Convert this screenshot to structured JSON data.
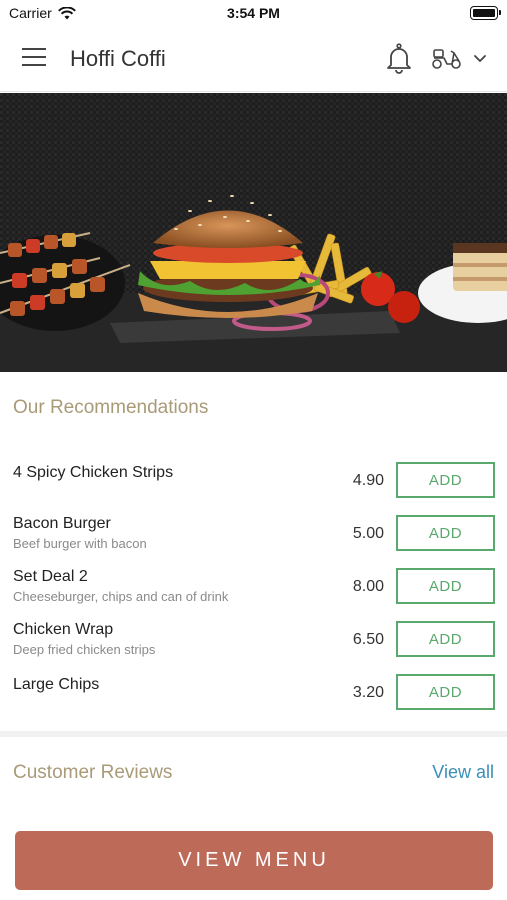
{
  "status_bar": {
    "carrier": "Carrier",
    "time": "3:54 PM"
  },
  "header": {
    "title": "Hoffi Coffi",
    "icons": [
      "menu-icon",
      "bell-icon",
      "scooter-icon",
      "chevron-down-icon"
    ]
  },
  "hero": {
    "image": "burger-fries-kebab-photo"
  },
  "recommendations": {
    "title": "Our Recommendations",
    "add_label": "ADD",
    "items": [
      {
        "name": "4 Spicy Chicken Strips",
        "description": "",
        "price": "4.90"
      },
      {
        "name": "Bacon Burger",
        "description": "Beef burger with bacon",
        "price": "5.00"
      },
      {
        "name": "Set Deal 2",
        "description": "Cheeseburger, chips and can of drink",
        "price": "8.00"
      },
      {
        "name": "Chicken Wrap",
        "description": "Deep fried chicken strips",
        "price": "6.50"
      },
      {
        "name": "Large Chips",
        "description": "",
        "price": "3.20"
      }
    ]
  },
  "reviews": {
    "title": "Customer Reviews",
    "view_all_label": "View all"
  },
  "footer": {
    "view_menu_label": "VIEW MENU"
  },
  "colors": {
    "accent_gold": "#a99a78",
    "add_green": "#5aa86e",
    "link_blue": "#3b8fb8",
    "cta_terracotta": "#bd6a59"
  }
}
